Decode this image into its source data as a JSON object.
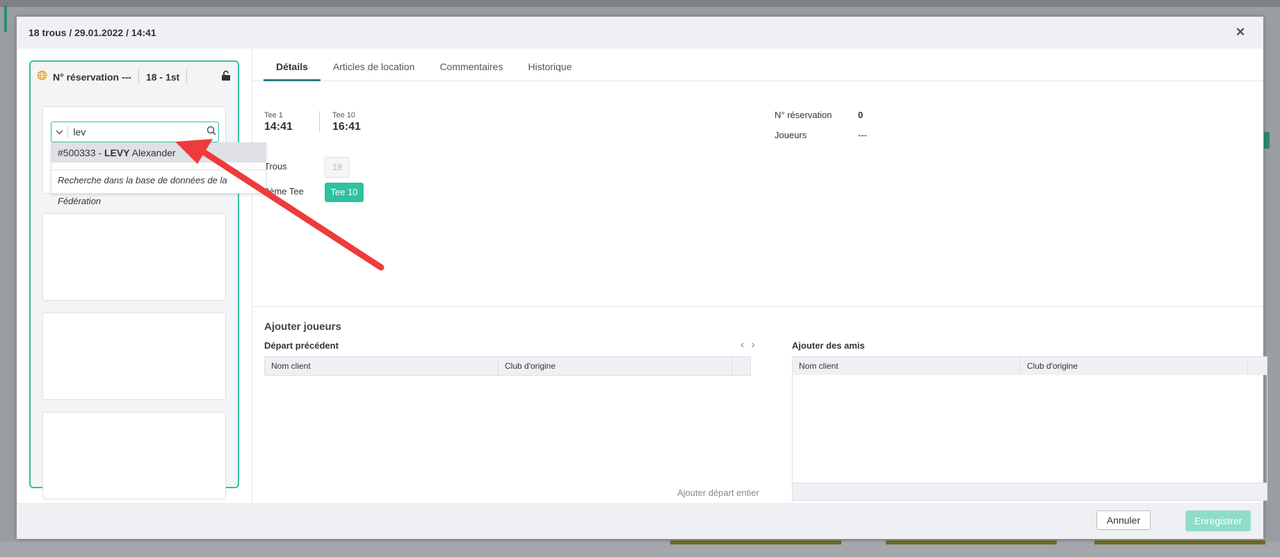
{
  "modal": {
    "title": "18 trous / 29.01.2022 / 14:41",
    "close_label": "×"
  },
  "left_panel": {
    "reservation_label": "N° réservation ---",
    "course_label": "18 - 1st",
    "search": {
      "value": "lev",
      "placeholder": ""
    },
    "dropdown": {
      "result_number": "#500333 - ",
      "result_lastname": "LEVY",
      "result_firstname": " Alexander",
      "federation_search": "Recherche dans la base de données de la Fédération"
    }
  },
  "tabs": [
    {
      "label": "Détails",
      "active": true
    },
    {
      "label": "Articles de location",
      "active": false
    },
    {
      "label": "Commentaires",
      "active": false
    },
    {
      "label": "Historique",
      "active": false
    }
  ],
  "details": {
    "tee1_label": "Tee 1",
    "tee1_time": "14:41",
    "tee10_label": "Tee 10",
    "tee10_time": "16:41",
    "holes_label": "Trous",
    "holes_value": "18",
    "second_tee_label": "2ème Tee",
    "second_tee_value": "Tee 10",
    "reservation_label": "N° réservation",
    "reservation_value": "0",
    "players_label": "Joueurs",
    "players_value": "---"
  },
  "add_players": {
    "title": "Ajouter joueurs",
    "previous_start_title": "Départ précédent",
    "add_friends_title": "Ajouter des amis",
    "columns": [
      "Nom client",
      "Club d'origine"
    ],
    "add_all_label": "Ajouter départ entier"
  },
  "footer": {
    "cancel_label": "Annuler",
    "save_label": "Enregistrer"
  },
  "colors": {
    "accent": "#2fc1a0",
    "tab_underline": "#2a7d86",
    "globe": "#e8a21e",
    "annotation_arrow": "#ee3b3b"
  }
}
